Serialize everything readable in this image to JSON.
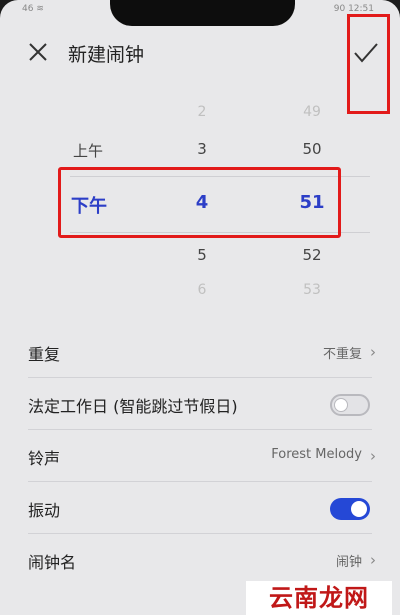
{
  "status": {
    "left": "46 ≋",
    "right": "90 12:51"
  },
  "header": {
    "title": "新建闹钟",
    "close_icon": "close-icon",
    "confirm_icon": "check-icon"
  },
  "picker": {
    "period": {
      "above": "上午",
      "selected": "下午"
    },
    "hour": {
      "above2": "2",
      "above1": "3",
      "selected": "4",
      "below1": "5",
      "below2": "6"
    },
    "minute": {
      "above2": "49",
      "above1": "50",
      "selected": "51",
      "below1": "52",
      "below2": "53"
    }
  },
  "settings": {
    "repeat": {
      "label": "重复",
      "value": "不重复"
    },
    "holiday": {
      "label": "法定工作日 (智能跳过节假日)",
      "enabled": false
    },
    "ringtone": {
      "label": "铃声",
      "value": "Forest Melody"
    },
    "vibrate": {
      "label": "振动",
      "enabled": true
    },
    "name": {
      "label": "闹钟名",
      "value": "闹钟"
    }
  },
  "colors": {
    "accent": "#2548d6",
    "highlight_box": "#e21a1a",
    "background": "#e8e8ea"
  },
  "watermark": {
    "text": "云南龙网"
  }
}
